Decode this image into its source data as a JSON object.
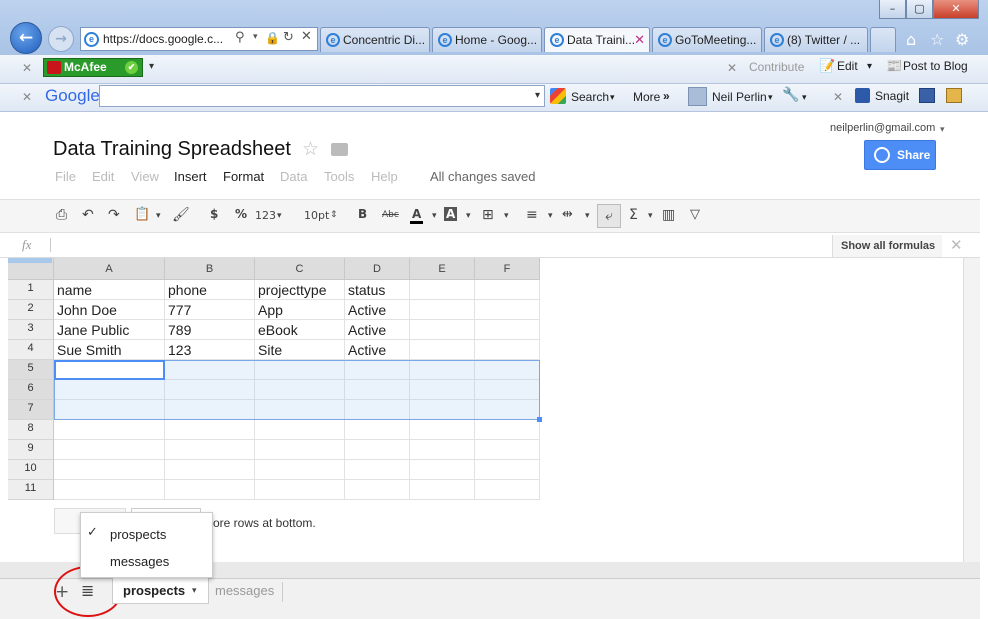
{
  "browser": {
    "address": "https://docs.google.c...",
    "tabs": [
      {
        "label": "Concentric Di..."
      },
      {
        "label": "Home - Goog..."
      },
      {
        "label": "Data Traini..."
      },
      {
        "label": "GoToMeeting..."
      },
      {
        "label": "(8) Twitter / ..."
      }
    ],
    "mcafee_label": "McAfee",
    "contribute_label": "Contribute",
    "edit_label": "Edit",
    "post_label": "Post to Blog",
    "google_logo": "Google",
    "search_label": "Search",
    "more_label": "More",
    "user_label": "Neil Perlin",
    "snagit_label": "Snagit"
  },
  "doc": {
    "title": "Data Training Spreadsheet",
    "user_email": "neilperlin@gmail.com",
    "share_label": "Share",
    "menus": [
      "File",
      "Edit",
      "View",
      "Insert",
      "Format",
      "Data",
      "Tools",
      "Help"
    ],
    "saved_status": "All changes saved",
    "show_formulas": "Show all formulas",
    "fx_label": "fx"
  },
  "toolbar": {
    "currency": "$",
    "percent": "%",
    "number_format": "123",
    "font_size": "10pt",
    "bold": "B",
    "strikethrough": "Abc",
    "text_color": "A",
    "fill_color": "A",
    "sum": "Σ"
  },
  "grid": {
    "columns": [
      "A",
      "B",
      "C",
      "D",
      "E",
      "F"
    ],
    "rows": [
      "1",
      "2",
      "3",
      "4",
      "5",
      "6",
      "7",
      "8",
      "9",
      "10",
      "11"
    ],
    "cells": [
      [
        "name",
        "phone",
        "projecttype",
        "status"
      ],
      [
        "John Doe",
        "777",
        "App",
        "Active"
      ],
      [
        "Jane Public",
        "789",
        "eBook",
        "Active"
      ],
      [
        "Sue Smith",
        "123",
        "Site",
        "Active"
      ]
    ]
  },
  "add_rows_text": "more rows at bottom.",
  "sheet_menu": {
    "items": [
      "prospects",
      "messages"
    ],
    "checked": "prospects"
  },
  "sheets": {
    "active": "prospects",
    "other": "messages",
    "add": "+"
  }
}
